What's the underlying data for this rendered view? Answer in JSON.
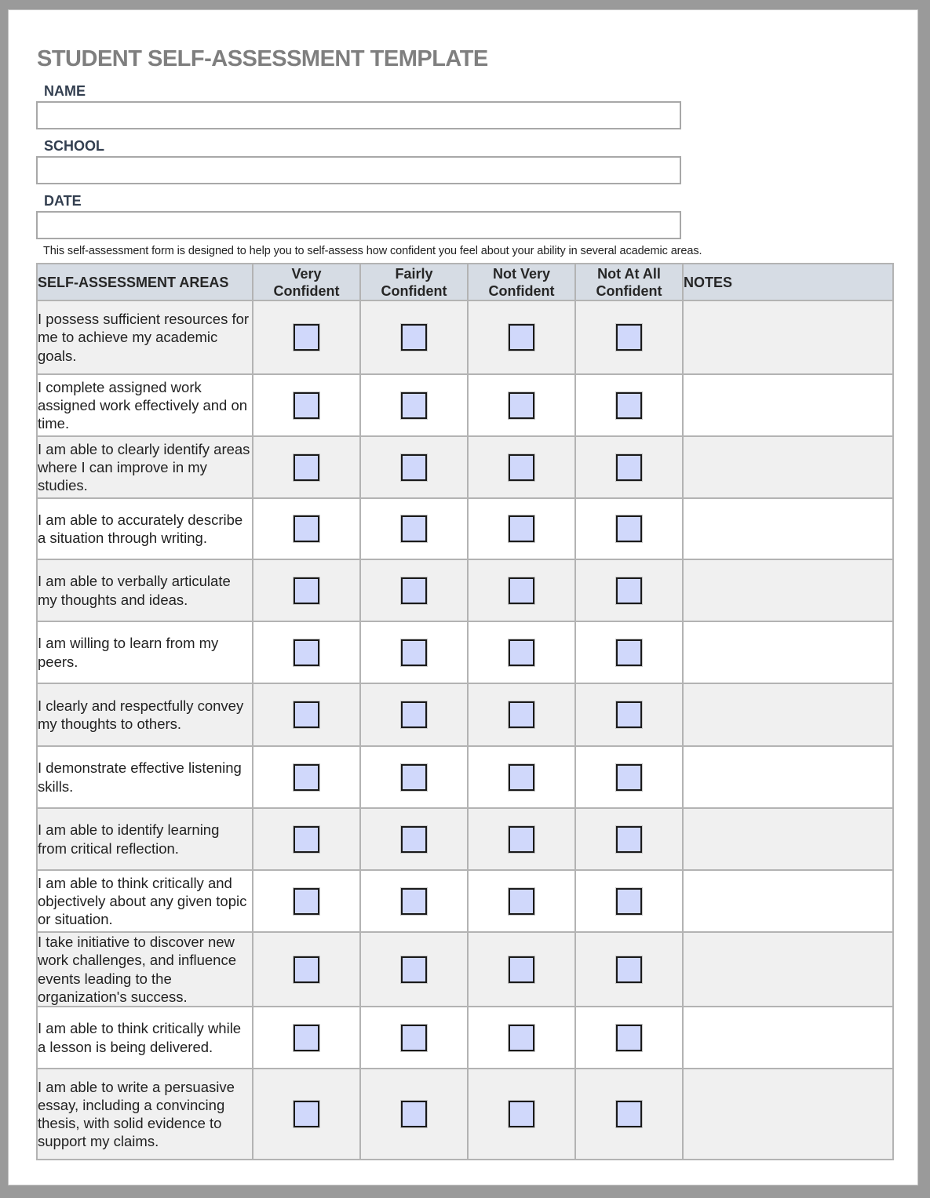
{
  "document": {
    "title": "STUDENT SELF-ASSESSMENT TEMPLATE",
    "fields": [
      {
        "label": "NAME",
        "value": ""
      },
      {
        "label": "SCHOOL",
        "value": ""
      },
      {
        "label": "DATE",
        "value": ""
      }
    ],
    "intro": "This self-assessment form is designed to help you to self-assess how confident you feel about your ability in several academic areas."
  },
  "table": {
    "headers": {
      "area": "SELF-ASSESSMENT AREAS",
      "levels": [
        {
          "line1": "Very",
          "line2": "Confident"
        },
        {
          "line1": "Fairly",
          "line2": "Confident"
        },
        {
          "line1": "Not Very",
          "line2": "Confident"
        },
        {
          "line1": "Not At All",
          "line2": "Confident"
        }
      ],
      "notes": "NOTES"
    },
    "rows": [
      {
        "text": "I possess sufficient resources for me to achieve my academic goals.",
        "checked": [
          false,
          false,
          false,
          false
        ],
        "notes": ""
      },
      {
        "text": "I complete assigned work assigned work effectively and on time.",
        "checked": [
          false,
          false,
          false,
          false
        ],
        "notes": ""
      },
      {
        "text": "I am able to clearly identify areas where I can improve in my studies.",
        "checked": [
          false,
          false,
          false,
          false
        ],
        "notes": ""
      },
      {
        "text": "I am able to accurately describe a situation through writing.",
        "checked": [
          false,
          false,
          false,
          false
        ],
        "notes": ""
      },
      {
        "text": "I am able to verbally articulate my thoughts and ideas.",
        "checked": [
          false,
          false,
          false,
          false
        ],
        "notes": ""
      },
      {
        "text": "I am willing to learn from my peers.",
        "checked": [
          false,
          false,
          false,
          false
        ],
        "notes": ""
      },
      {
        "text": "I clearly and respectfully convey my thoughts to others.",
        "checked": [
          false,
          false,
          false,
          false
        ],
        "notes": ""
      },
      {
        "text": "I demonstrate effective listening skills.",
        "checked": [
          false,
          false,
          false,
          false
        ],
        "notes": ""
      },
      {
        "text": "I am able to identify learning from critical reflection.",
        "checked": [
          false,
          false,
          false,
          false
        ],
        "notes": ""
      },
      {
        "text": "I am able to think critically and objectively about any given topic or situation.",
        "checked": [
          false,
          false,
          false,
          false
        ],
        "notes": ""
      },
      {
        "text": "I take initiative to discover new work challenges, and influence events leading to the organization's success.",
        "checked": [
          false,
          false,
          false,
          false
        ],
        "notes": ""
      },
      {
        "text": "I am able to think critically while a lesson is being delivered.",
        "checked": [
          false,
          false,
          false,
          false
        ],
        "notes": ""
      },
      {
        "text": "I am able to write a persuasive essay, including a convincing thesis, with solid evidence to support my claims.",
        "checked": [
          false,
          false,
          false,
          false
        ],
        "notes": ""
      }
    ]
  },
  "colors": {
    "title": "#7f7f7f",
    "label": "#333f50",
    "header_bg": "#d6dce4",
    "row_shade": "#f0f0f0",
    "checkbox_fill": "#d0d8fb"
  }
}
